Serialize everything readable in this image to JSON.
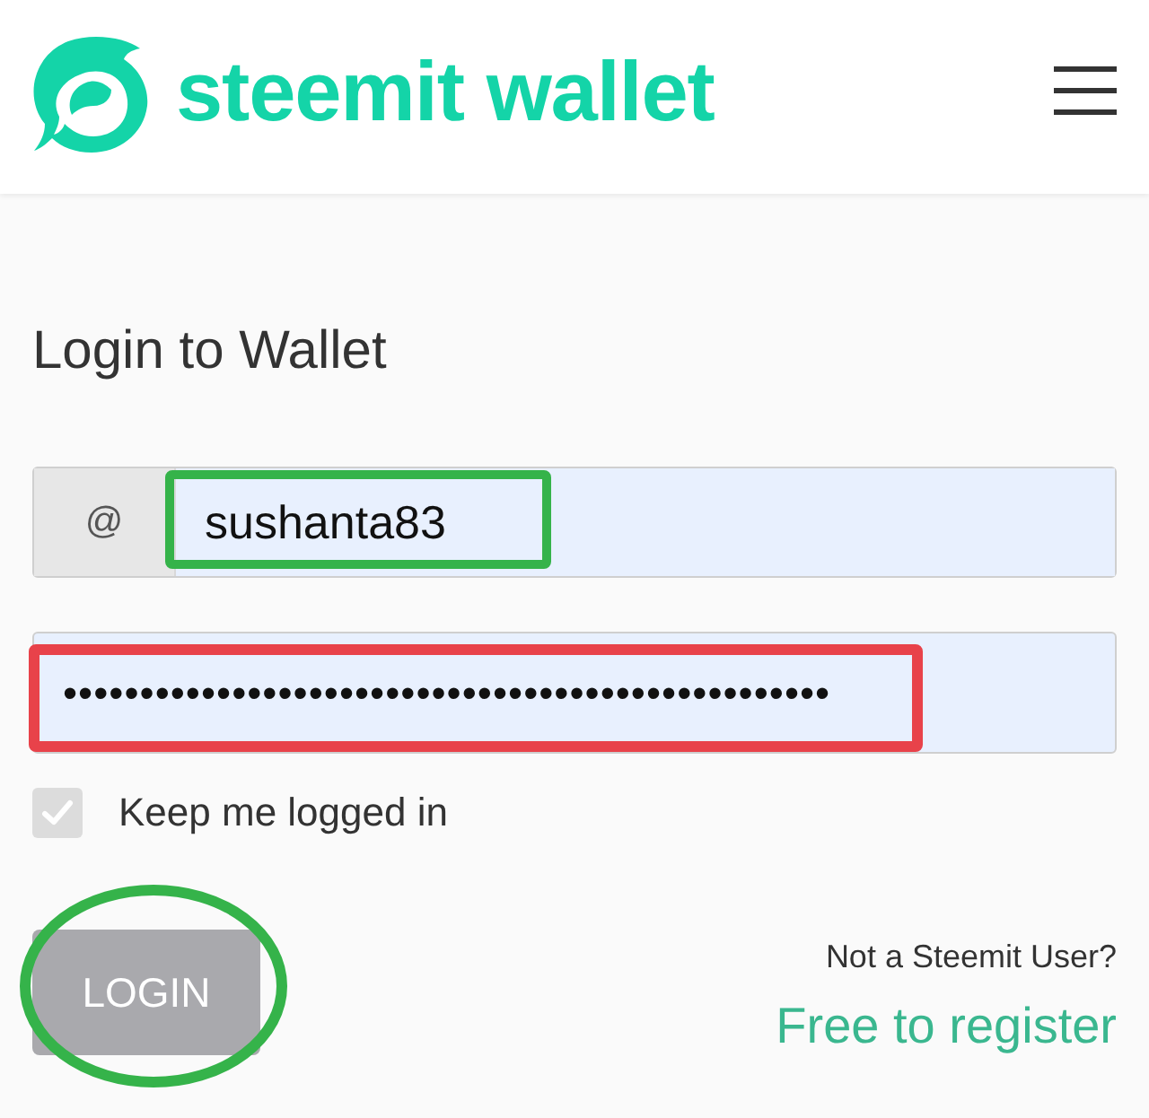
{
  "header": {
    "logo_text": "steemit wallet"
  },
  "form": {
    "title": "Login to Wallet",
    "username": {
      "prefix": "@",
      "value": "sushanta83",
      "highlight": {
        "kind": "rect",
        "color": "#35b34a"
      }
    },
    "password": {
      "value": "••••••••••••••••••••••••••••••••••••••••••••••••••",
      "highlight": {
        "kind": "rect",
        "color": "#e8424a"
      }
    },
    "keep_logged_in": {
      "label": "Keep me logged in",
      "checked": true,
      "disabled": true
    },
    "login_button": {
      "label": "LOGIN",
      "disabled": true,
      "highlight": {
        "kind": "ellipse",
        "color": "#35b34a"
      }
    },
    "register": {
      "prompt": "Not a Steemit User?",
      "link": "Free to register"
    }
  }
}
